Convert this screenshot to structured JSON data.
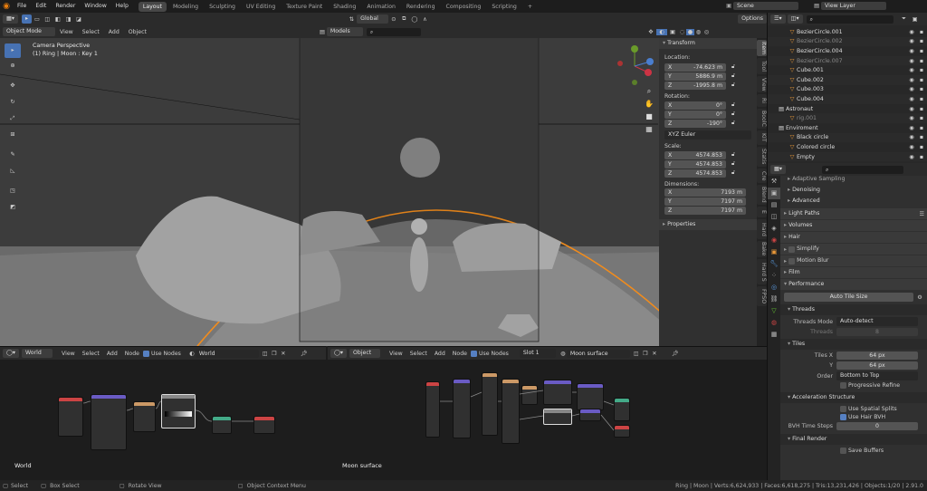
{
  "menu": [
    "File",
    "Edit",
    "Render",
    "Window",
    "Help"
  ],
  "workspaces": [
    "Layout",
    "Modeling",
    "Sculpting",
    "UV Editing",
    "Texture Paint",
    "Shading",
    "Animation",
    "Rendering",
    "Compositing",
    "Scripting"
  ],
  "scene": "Scene",
  "view_layer": "View Layer",
  "viewport": {
    "mode": "Object Mode",
    "menus": [
      "View",
      "Select",
      "Add",
      "Object"
    ],
    "orient": "Global",
    "options": "Options",
    "overlay_title": "Camera Perspective",
    "overlay_sub": "(1) Ring | Moon : Key 1",
    "collection": "Models"
  },
  "npanel": {
    "tabs": [
      "Item",
      "Tool",
      "View",
      "Ri",
      "BoolC",
      "KIT",
      "Statis",
      "Cre",
      "Blend",
      "E",
      "Hard",
      "Bake",
      "Hard S",
      "FPSO"
    ],
    "transform": "Transform",
    "location": "Location:",
    "loc": [
      [
        "X",
        "-74.623 m"
      ],
      [
        "Y",
        "5886.9 m"
      ],
      [
        "Z",
        "-1995.8 m"
      ]
    ],
    "rotation": "Rotation:",
    "rot": [
      [
        "X",
        "0°"
      ],
      [
        "Y",
        "0°"
      ],
      [
        "Z",
        "-190°"
      ]
    ],
    "euler": "XYZ Euler",
    "scale": "Scale:",
    "scl": [
      [
        "X",
        "4574.853"
      ],
      [
        "Y",
        "4574.853"
      ],
      [
        "Z",
        "4574.853"
      ]
    ],
    "dimensions": "Dimensions:",
    "dim": [
      [
        "X",
        "7193 m"
      ],
      [
        "Y",
        "7197 m"
      ],
      [
        "Z",
        "7197 m"
      ]
    ],
    "properties": "Properties"
  },
  "outliner": [
    {
      "name": "BezierCircle.001",
      "ind": 1,
      "dim": false
    },
    {
      "name": "BezierCircle.002",
      "ind": 1,
      "dim": true
    },
    {
      "name": "BezierCircle.004",
      "ind": 1,
      "dim": false
    },
    {
      "name": "BezierCircle.007",
      "ind": 1,
      "dim": true
    },
    {
      "name": "Cube.001",
      "ind": 1,
      "dim": false
    },
    {
      "name": "Cube.002",
      "ind": 1,
      "dim": false
    },
    {
      "name": "Cube.003",
      "ind": 1,
      "dim": false
    },
    {
      "name": "Cube.004",
      "ind": 1,
      "dim": false
    },
    {
      "name": "Astronaut",
      "ind": 0,
      "dim": false
    },
    {
      "name": "rig.001",
      "ind": 1,
      "dim": true
    },
    {
      "name": "Enviroment",
      "ind": 0,
      "dim": false
    },
    {
      "name": "Black circle",
      "ind": 1,
      "dim": false
    },
    {
      "name": "Colored circle",
      "ind": 1,
      "dim": false
    },
    {
      "name": "Empty",
      "ind": 1,
      "dim": false
    }
  ],
  "props": {
    "adaptive": "Adaptive Sampling",
    "denoising": "Denoising",
    "advanced": "Advanced",
    "light_paths": "Light Paths",
    "volumes": "Volumes",
    "hair": "Hair",
    "simplify": "Simplify",
    "motion_blur": "Motion Blur",
    "film": "Film",
    "performance": "Performance",
    "auto_tile": "Auto Tile Size",
    "threads": "Threads",
    "threads_mode_lbl": "Threads Mode",
    "threads_mode": "Auto-detect",
    "threads_lbl": "Threads",
    "threads_val": "8",
    "tiles": "Tiles",
    "tiles_x_lbl": "Tiles X",
    "tiles_x": "64 px",
    "y_lbl": "Y",
    "tiles_y": "64 px",
    "order_lbl": "Order",
    "order": "Bottom to Top",
    "progressive": "Progressive Refine",
    "accel": "Acceleration Structure",
    "spatial": "Use Spatial Splits",
    "hair_bvh": "Use Hair BVH",
    "bvh_lbl": "BVH Time Steps",
    "bvh_val": "0",
    "final": "Final Render",
    "save_buffers": "Save Buffers"
  },
  "node_left": {
    "type": "World",
    "menus": [
      "View",
      "Select",
      "Add",
      "Node"
    ],
    "use_nodes": "Use Nodes",
    "name": "World",
    "label": "World"
  },
  "node_right": {
    "type": "Object",
    "menus": [
      "View",
      "Select",
      "Add",
      "Node"
    ],
    "use_nodes": "Use Nodes",
    "slot": "Slot 1",
    "name": "Moon surface",
    "label": "Moon surface"
  },
  "status": {
    "select": "Select",
    "box": "Box Select",
    "rotate": "Rotate View",
    "ctx": "Object Context Menu",
    "stats": "Ring | Moon | Verts:6,624,933 | Faces:6,618,275 | Tris:13,231,426 | Objects:1/20 | 2.91.0"
  },
  "colors": {
    "accent": "#5680c2",
    "orange": "#f28c1c",
    "active": "#4772b3"
  }
}
